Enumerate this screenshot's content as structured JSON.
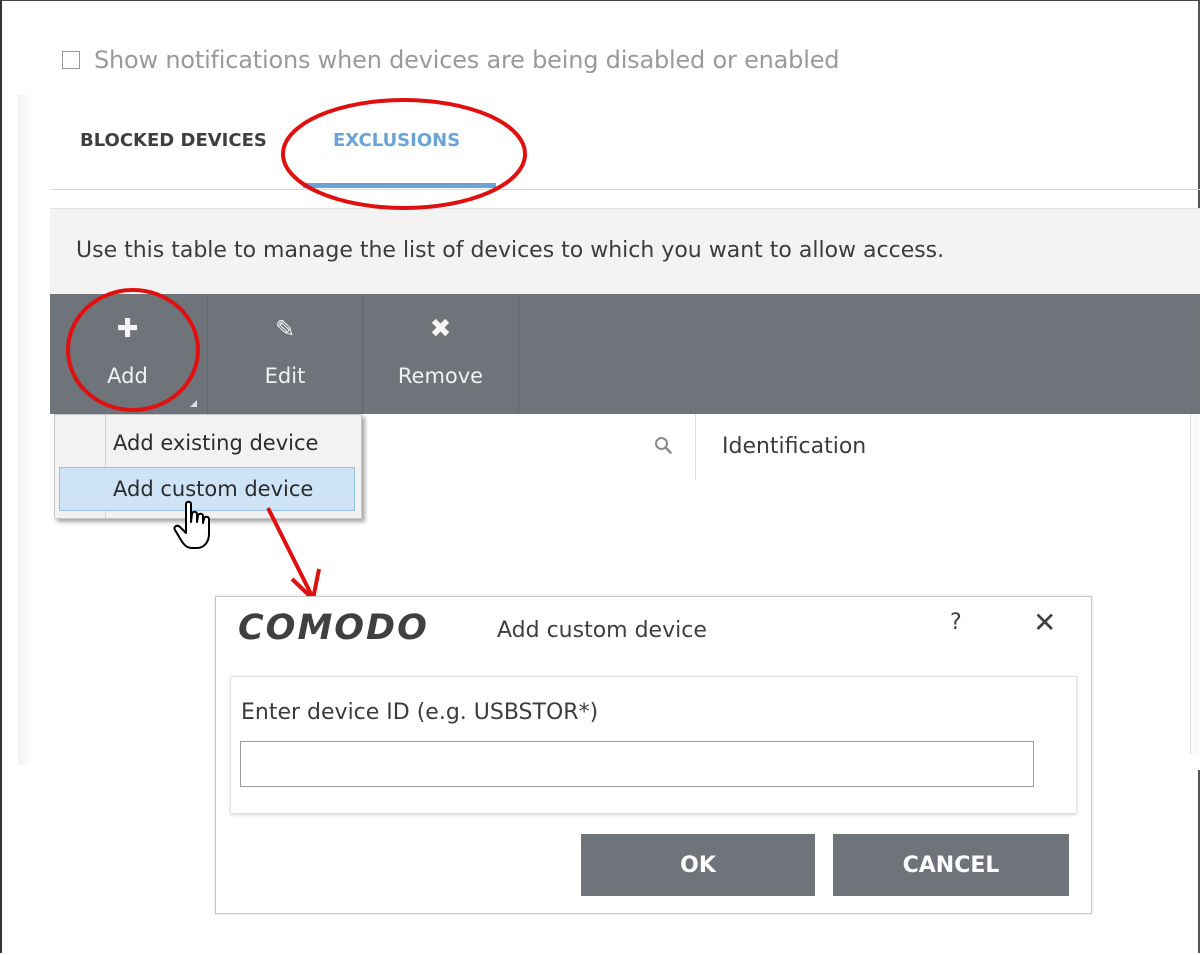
{
  "notification_checkbox": {
    "label": "Show notifications when devices are being disabled or enabled",
    "checked": false
  },
  "tabs": [
    {
      "label": "BLOCKED DEVICES",
      "active": false
    },
    {
      "label": "EXCLUSIONS",
      "active": true
    }
  ],
  "panel": {
    "description": "Use this table to manage the list of devices to which you want to allow access."
  },
  "toolbar": {
    "add_label": "Add",
    "edit_label": "Edit",
    "remove_label": "Remove"
  },
  "add_dropdown": {
    "items": [
      "Add existing device",
      "Add custom device"
    ],
    "highlighted": "Add custom device"
  },
  "table": {
    "columns": [
      "Identification"
    ]
  },
  "dialog": {
    "logo": "COMODO",
    "title": "Add custom device",
    "help": "?",
    "close": "✕",
    "field_label": "Enter device ID (e.g. USBSTOR*)",
    "field_value": "",
    "ok_label": "OK",
    "cancel_label": "CANCEL"
  },
  "colors": {
    "toolbar": "#6f737a",
    "accent_tab": "#6aa3d5",
    "annotation": "#e01010",
    "dropdown_highlight": "#cfe3f7"
  }
}
